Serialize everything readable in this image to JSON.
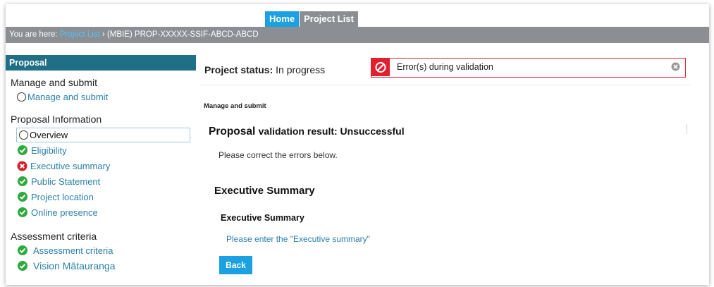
{
  "nav": {
    "tabs": [
      {
        "label": "Home"
      },
      {
        "label": "Project List"
      }
    ]
  },
  "breadcrumb": {
    "prefix": "You are here: ",
    "link": "Project List",
    "separator": " › ",
    "current": "(MBIE) PROP-XXXXX-SSIF-ABCD-ABCD"
  },
  "sidebar": {
    "header": "Proposal",
    "sections": [
      {
        "title": "Manage and submit",
        "items": [
          {
            "label": "Manage and submit",
            "status": "circle-icon"
          }
        ]
      },
      {
        "title": "Proposal Information",
        "items": [
          {
            "label": "Overview",
            "status": "circle-icon"
          },
          {
            "label": "Eligibility",
            "status": "check-icon"
          },
          {
            "label": "Executive summary",
            "status": "error-icon"
          },
          {
            "label": "Public Statement",
            "status": "check-icon"
          },
          {
            "label": "Project location",
            "status": "check-icon"
          },
          {
            "label": "Online presence",
            "status": "check-icon"
          }
        ]
      },
      {
        "title": "Assessment criteria",
        "items": [
          {
            "label": "Assessment criteria",
            "status": "check-icon"
          },
          {
            "label": "Vision Mātauranga",
            "status": "check-icon"
          }
        ]
      }
    ]
  },
  "main": {
    "status_label": "Project status:",
    "status_value": " In progress",
    "error_banner": "Error(s) during validation",
    "small_heading": "Manage and submit",
    "result_title_a": "Proposal ",
    "result_title_b": "validation result: Unsuccessful",
    "correct_text": "Please correct the errors below.",
    "section_title": "Executive Summary",
    "sub_title": "Executive Summary",
    "error_message": "Please enter the \"Executive summary\"",
    "back_button": "Back"
  },
  "colors": {
    "accent": "#1ba1e2",
    "sidebar_header": "#1f6f86",
    "gray_bar": "#8b8f94",
    "error": "#e0202e",
    "success": "#2eaa3c",
    "link": "#2a7fa8"
  }
}
